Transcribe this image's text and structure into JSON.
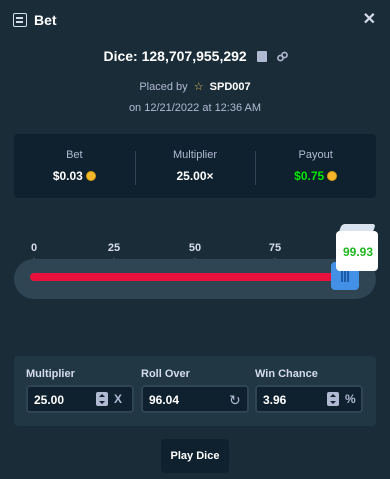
{
  "header": {
    "title": "Bet",
    "icon": "bet-slip-icon",
    "close": "✕"
  },
  "dice": {
    "title": "Dice: 128,707,955,292"
  },
  "placed": {
    "prefix": "Placed by",
    "star": "☆",
    "user": "SPD007"
  },
  "date": "on 12/21/2022 at 12:36 AM",
  "stats": {
    "bet_label": "Bet",
    "bet_value": "$0.03",
    "multiplier_label": "Multiplier",
    "multiplier_value": "25.00×",
    "payout_label": "Payout",
    "payout_value": "$0.75"
  },
  "slider": {
    "ticks": [
      "0",
      "25",
      "50",
      "75"
    ],
    "roll_over": 96.04,
    "result": "99.93",
    "lose_color": "#e9113c",
    "win_color": "#00e701"
  },
  "controls": {
    "multiplier_label": "Multiplier",
    "multiplier_value": "25.00",
    "multiplier_suffix": "X",
    "roll_over_label": "Roll Over",
    "roll_over_value": "96.04",
    "win_chance_label": "Win Chance",
    "win_chance_value": "3.96",
    "win_chance_suffix": "%"
  },
  "play_button": "Play Dice"
}
